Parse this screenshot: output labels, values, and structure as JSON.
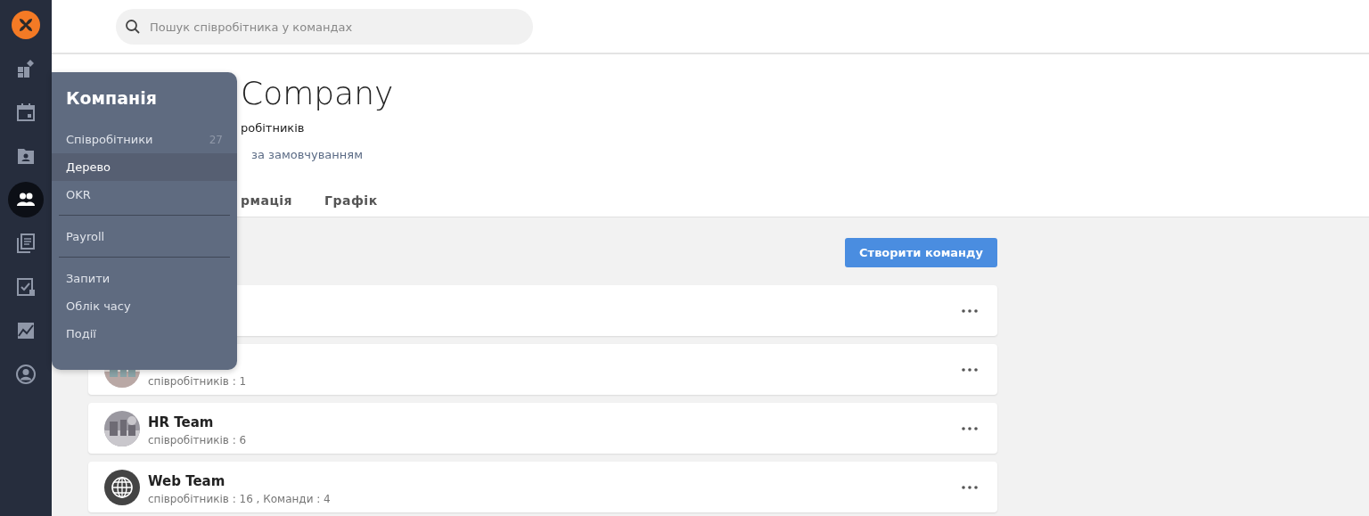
{
  "sidebar": {
    "items": [
      {
        "kind": "logo",
        "selected": false
      },
      {
        "kind": "dashboard",
        "selected": false
      },
      {
        "kind": "calendar",
        "selected": false
      },
      {
        "kind": "contact",
        "selected": false
      },
      {
        "kind": "people",
        "selected": true
      },
      {
        "kind": "documents",
        "selected": false
      },
      {
        "kind": "tasks",
        "selected": false
      },
      {
        "kind": "chart",
        "selected": false
      },
      {
        "kind": "profile",
        "selected": false
      }
    ]
  },
  "search": {
    "placeholder": "Пошук співробітника у командах"
  },
  "header": {
    "title": "Company",
    "subtitle": "робітників",
    "link": "за замовчуванням"
  },
  "tabs": [
    {
      "label": "рмація",
      "selected": false
    },
    {
      "label": "Графік",
      "selected": false
    }
  ],
  "create_button": "Створити команду",
  "teams": [
    {
      "kind": "blank"
    },
    {
      "meta": "співробітників : 1"
    },
    {
      "name": "HR Team",
      "meta": "співробітників : 6"
    },
    {
      "kind": "globe",
      "name": "Web Team",
      "meta": "співробітників : 16 , Команди : 4"
    }
  ],
  "menu": {
    "title": "Компанія",
    "groups": [
      [
        {
          "label": "Співробітники",
          "count": "27",
          "selected": false
        },
        {
          "label": "Дерево",
          "selected": true
        },
        {
          "label": "OKR",
          "selected": false
        }
      ],
      [
        {
          "label": "Payroll",
          "selected": false
        }
      ],
      [
        {
          "label": "Запити",
          "selected": false
        },
        {
          "label": "Облік часу",
          "selected": false
        },
        {
          "label": "Події",
          "selected": false
        }
      ]
    ]
  }
}
